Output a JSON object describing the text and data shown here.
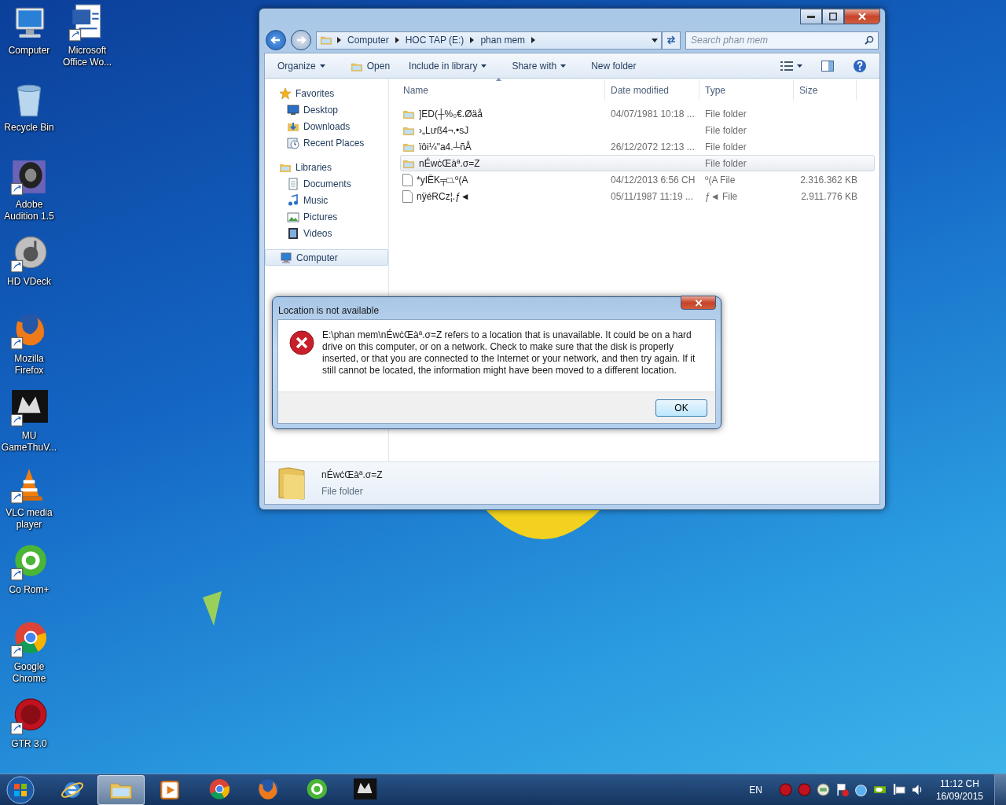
{
  "desktop": {
    "columns": [
      [
        {
          "label": "Computer",
          "kind": "computer",
          "shortcut": false
        },
        {
          "label": "Recycle Bin",
          "kind": "recycle",
          "shortcut": false
        },
        {
          "label": "Adobe Audition 1.5",
          "kind": "speaker",
          "shortcut": true
        },
        {
          "label": "HD VDeck",
          "kind": "disc",
          "shortcut": true
        },
        {
          "label": "Mozilla Firefox",
          "kind": "firefox",
          "shortcut": true
        },
        {
          "label": "MU GameThuV...",
          "kind": "mu",
          "shortcut": true
        },
        {
          "label": "VLC media player",
          "kind": "vlc",
          "shortcut": true
        },
        {
          "label": "Co Rom+",
          "kind": "coccoc",
          "shortcut": true
        },
        {
          "label": "Google Chrome",
          "kind": "chrome",
          "shortcut": true
        },
        {
          "label": "GTR 3.0",
          "kind": "gtr",
          "shortcut": true
        }
      ],
      [
        {
          "label": "Microsoft Office Wo...",
          "kind": "word",
          "shortcut": true
        }
      ]
    ]
  },
  "explorer": {
    "breadcrumbs": [
      "Computer",
      "HOC TAP (E:)",
      "phan mem"
    ],
    "search": {
      "placeholder": "Search phan mem"
    },
    "toolbar": [
      {
        "label": "Organize",
        "kind": "menu"
      },
      {
        "label": "Open",
        "kind": "open"
      },
      {
        "label": "Include in library",
        "kind": "menu"
      },
      {
        "label": "Share with",
        "kind": "menu"
      },
      {
        "label": "New folder",
        "kind": "plain"
      }
    ],
    "nav": [
      {
        "label": "Favorites",
        "kind": "star",
        "selected": false,
        "children": [
          {
            "label": "Desktop",
            "kind": "desktop",
            "selected": false
          },
          {
            "label": "Downloads",
            "kind": "downloads",
            "selected": false
          },
          {
            "label": "Recent Places",
            "kind": "recent",
            "selected": false
          }
        ]
      },
      {
        "label": "Libraries",
        "kind": "library",
        "selected": false,
        "children": [
          {
            "label": "Documents",
            "kind": "documents",
            "selected": false
          },
          {
            "label": "Music",
            "kind": "music",
            "selected": false
          },
          {
            "label": "Pictures",
            "kind": "pictures",
            "selected": false
          },
          {
            "label": "Videos",
            "kind": "videos",
            "selected": false
          }
        ]
      },
      {
        "label": "Computer",
        "kind": "computer",
        "selected": true
      }
    ],
    "columns": [
      "Name",
      "Date modified",
      "Type",
      "Size"
    ],
    "files": [
      {
        "name": "]ED(┼%₀€.Øäå",
        "date": "04/07/1981 10:18 ...",
        "type": "File folder",
        "kind": "folder",
        "selected": false
      },
      {
        "name": "›„Lưß4¬.•sJ",
        "type": "File folder",
        "kind": "folder",
        "selected": false
      },
      {
        "name": "ïôi¼\"a4.┴ñÅ",
        "date": "26/12/2072 12:13 ...",
        "type": "File folder",
        "kind": "folder",
        "selected": false
      },
      {
        "name": "nÉwċŒàª.σ=Z",
        "type": "File folder",
        "kind": "folder",
        "selected": true
      },
      {
        "name": "*yIËK╤□.º(A",
        "date": "04/12/2013 6:56 CH",
        "type": "º(A File",
        "size": "2.316.362 KB",
        "kind": "file",
        "selected": false
      },
      {
        "name": "nÿéRCz¦.ƒ◄",
        "date": "05/11/1987 11:19 ...",
        "type": "ƒ◄ File",
        "size": "2.911.776 KB",
        "kind": "file",
        "selected": false
      }
    ],
    "details": {
      "name": "nÉwċŒàª.σ=Z",
      "type": "File folder"
    }
  },
  "dialog": {
    "title": "Location is not available",
    "message": "E:\\phan mem\\nÉwċŒàª.σ=Z refers to a location that is unavailable. It could be on a hard drive on this computer, or on a network. Check to make sure that the disk is properly inserted, or that you are connected to the Internet or your network, and then try again. If it still cannot be located, the information might have been moved to a different location.",
    "button": "OK"
  },
  "taskbar": {
    "apps": [
      {
        "kind": "ie",
        "selected": false
      },
      {
        "kind": "explorer",
        "selected": true
      },
      {
        "kind": "media",
        "selected": false
      },
      {
        "kind": "chrome",
        "selected": false
      },
      {
        "kind": "firefox",
        "selected": false
      },
      {
        "kind": "coccoc",
        "selected": false
      },
      {
        "kind": "mu",
        "selected": false
      }
    ],
    "language": "EN",
    "tray": [
      {
        "kind": "red-badge"
      },
      {
        "kind": "red-badge"
      },
      {
        "kind": "face"
      },
      {
        "kind": "flag"
      },
      {
        "kind": "drop"
      },
      {
        "kind": "nvidia"
      },
      {
        "kind": "network"
      },
      {
        "kind": "volume"
      }
    ],
    "time": "11:12 CH",
    "date": "16/09/2015"
  }
}
